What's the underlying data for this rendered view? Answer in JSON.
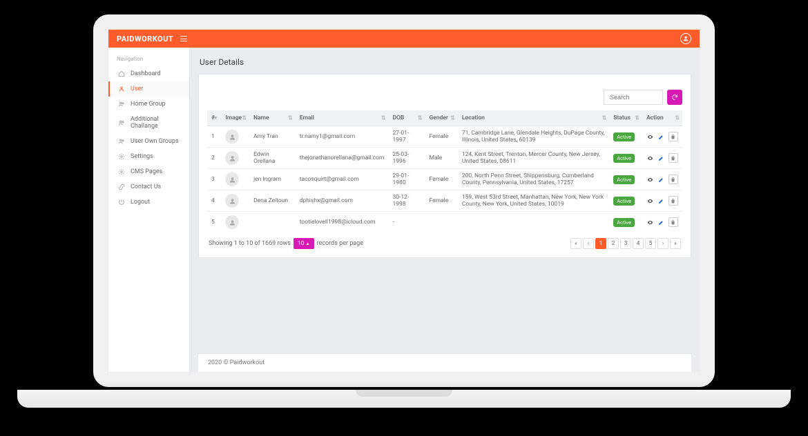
{
  "brand": "PAIDWORKOUT",
  "sidebar": {
    "title": "Navigation",
    "items": [
      {
        "label": "Dashboard",
        "icon": "home-icon"
      },
      {
        "label": "User",
        "icon": "user-icon",
        "active": true
      },
      {
        "label": "Home Group",
        "icon": "users-icon"
      },
      {
        "label": "Additional Challange",
        "icon": "users-icon"
      },
      {
        "label": "User Own Groups",
        "icon": "users-icon"
      },
      {
        "label": "Settings",
        "icon": "gear-icon"
      },
      {
        "label": "CMS Pages",
        "icon": "gear-icon"
      },
      {
        "label": "Contact Us",
        "icon": "link-icon"
      },
      {
        "label": "Logout",
        "icon": "logout-icon"
      }
    ]
  },
  "page": {
    "title": "User Details"
  },
  "search": {
    "placeholder": "Search"
  },
  "table": {
    "columns": [
      "#",
      "Image",
      "Name",
      "Email",
      "DOB",
      "Gender",
      "Location",
      "Status",
      "Action"
    ],
    "rows": [
      {
        "num": "1",
        "name": "Amy Tran",
        "email": "tr.namy1@gmail.com",
        "dob": "27-01-1997",
        "gender": "Female",
        "location": "71, Cambridge Lane, Glendale Heights, DuPage County, Illinois, United States, 60139",
        "status": "Active"
      },
      {
        "num": "2",
        "name": "Edwin Orellana",
        "email": "thejonathanorellana@gmail.com",
        "dob": "25-03-1996",
        "gender": "Male",
        "location": "124, Kent Street, Trenton, Mercer County, New Jersey, United States, 08611",
        "status": "Active"
      },
      {
        "num": "3",
        "name": "jen Ingram",
        "email": "tacosquirt@gmail.com",
        "dob": "29-01-1980",
        "gender": "Female",
        "location": "200, North Penn Street, Shippensburg, Cumberland County, Pennsylvania, United States, 17257",
        "status": "Active"
      },
      {
        "num": "4",
        "name": "Dena Zeitoun",
        "email": "dphishx@gmail.com",
        "dob": "30-12-1998",
        "gender": "Female",
        "location": "159, West 53rd Street, Manhattan, New York, New York County, New York, United States, 10019",
        "status": "Active"
      },
      {
        "num": "5",
        "name": "",
        "email": "tootielovell1998@icloud.com",
        "dob": "-",
        "gender": "",
        "location": "",
        "status": "Active"
      }
    ]
  },
  "footer_info": {
    "prefix": "Showing 1 to 10 of 1669 rows",
    "perpage": "10",
    "suffix": "records per page"
  },
  "pager": [
    "«",
    "‹",
    "1",
    "2",
    "3",
    "4",
    "5",
    "›",
    "»"
  ],
  "pager_active": "1",
  "copyright": "2020 © Paidworkout"
}
